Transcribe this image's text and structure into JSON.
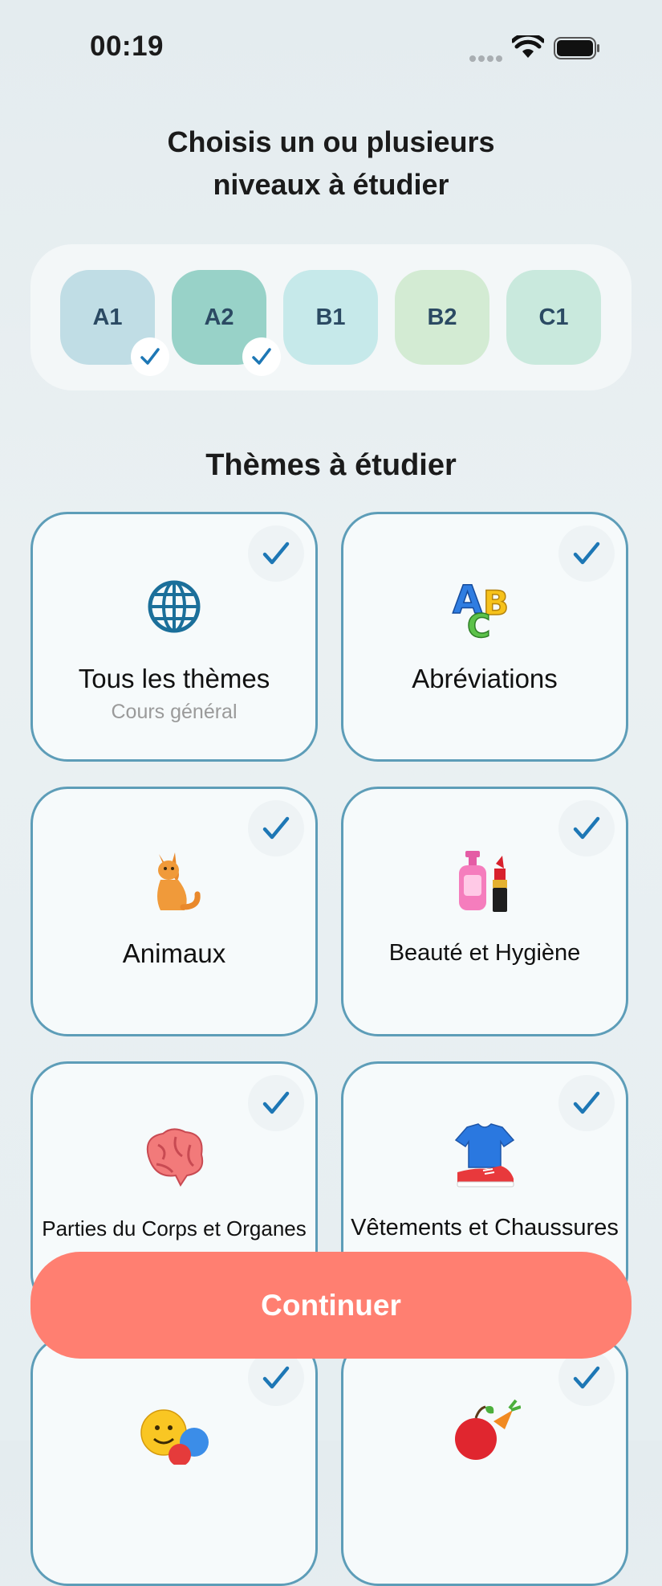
{
  "status_bar": {
    "time": "00:19"
  },
  "levels": {
    "title_line1": "Choisis un ou plusieurs",
    "title_line2": "niveaux à étudier",
    "items": [
      {
        "label": "A1",
        "selected": true,
        "color": "#c0dde5"
      },
      {
        "label": "A2",
        "selected": true,
        "color": "#98d2c8"
      },
      {
        "label": "B1",
        "selected": false,
        "color": "#c6e9ea"
      },
      {
        "label": "B2",
        "selected": false,
        "color": "#d3ebd3"
      },
      {
        "label": "C1",
        "selected": false,
        "color": "#c9e9dd"
      }
    ]
  },
  "themes": {
    "title": "Thèmes à étudier",
    "items": [
      {
        "label": "Tous les thèmes",
        "subtitle": "Cours général",
        "icon": "globe-icon",
        "selected": true
      },
      {
        "label": "Abréviations",
        "icon": "abc-letters-icon",
        "selected": true
      },
      {
        "label": "Animaux",
        "icon": "cat-icon",
        "selected": true
      },
      {
        "label": "Beauté et Hygiène",
        "icon": "lotion-lipstick-icon",
        "selected": true
      },
      {
        "label": "Parties du Corps et Organes",
        "icon": "brain-icon",
        "selected": true
      },
      {
        "label": "Vêtements et Chaussures",
        "icon": "shirt-sneaker-icon",
        "selected": true
      },
      {
        "label": "",
        "icon": "emotion-faces-icon",
        "selected": true
      },
      {
        "label": "",
        "icon": "apple-carrot-icon",
        "selected": true
      }
    ]
  },
  "continue_button": {
    "label": "Continuer",
    "color": "#ff7f71"
  },
  "colors": {
    "accent_check": "#1d77b5",
    "card_border": "#5d9db8"
  }
}
